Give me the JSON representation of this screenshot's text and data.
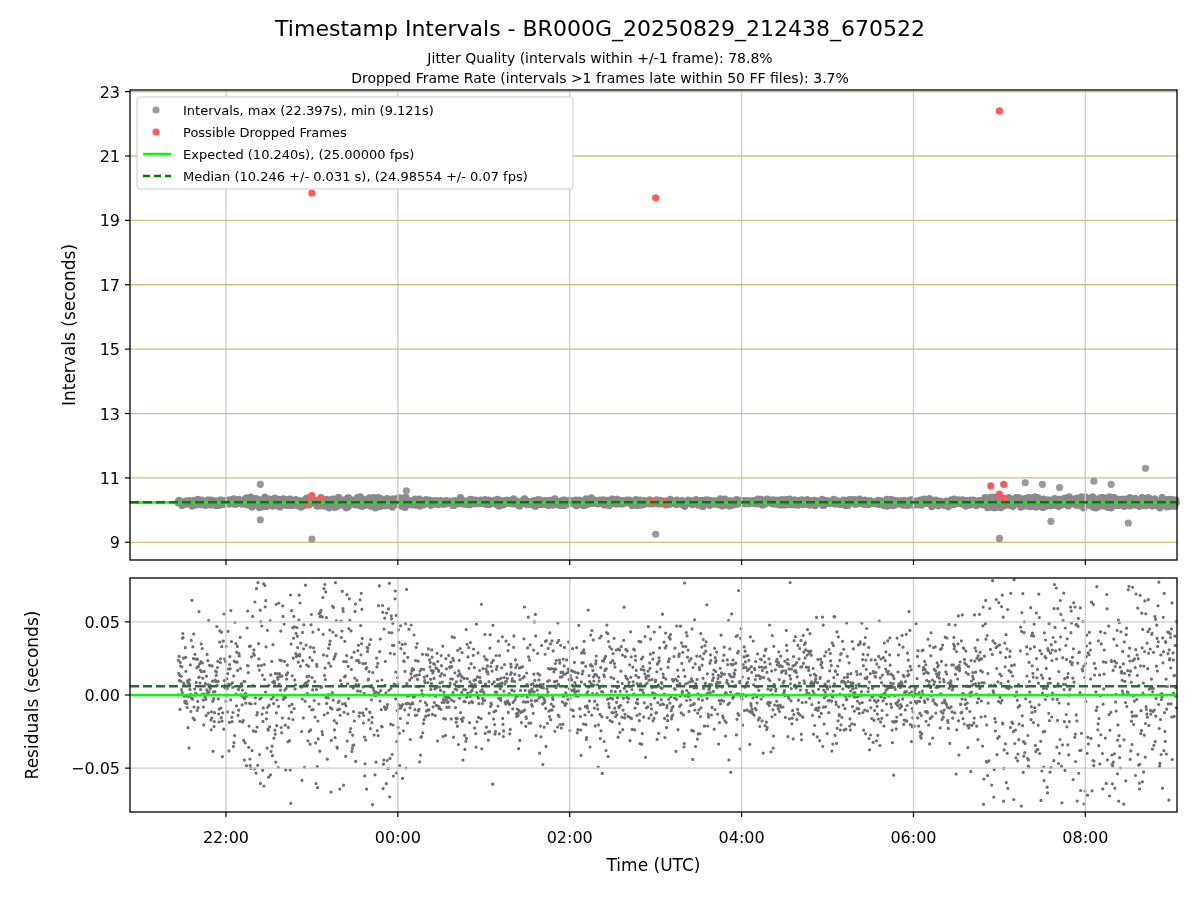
{
  "figure": {
    "title": "Timestamp Intervals - BR000G_20250829_212438_670522",
    "subtitle_lines": [
      "Jitter Quality (intervals within +/-1 frame): 78.8%",
      "Dropped Frame Rate (intervals >1 frames late within 50 FF files): 3.7%"
    ]
  },
  "intervals_plot": {
    "chart_data": {
      "type": "scatter",
      "ylabel": "Intervals (seconds)",
      "xlim": [
        "2025-08-29T20:53",
        "2025-08-30T09:04"
      ],
      "ylim": [
        8.45,
        23.05
      ],
      "yticks": [
        23,
        21,
        19,
        17,
        15,
        13,
        11,
        9
      ],
      "grid": true,
      "series": [
        {
          "name": "Intervals, max (22.397s), min (9.121s)",
          "color": "#999999",
          "x": [
            "2025-08-29T22:24",
            "2025-08-29T22:24",
            "2025-08-29T23:00",
            "2025-08-30T00:06",
            "2025-08-30T03:00",
            "2025-08-30T07:00",
            "2025-08-30T08:42",
            "2025-08-30T07:18",
            "2025-08-30T07:30",
            "2025-08-30T08:06",
            "2025-08-30T08:18",
            "2025-08-30T07:42",
            "2025-08-30T08:30",
            "2025-08-30T07:36"
          ],
          "values": [
            10.8,
            9.7,
            9.1,
            10.6,
            9.25,
            9.12,
            11.3,
            10.85,
            10.8,
            10.9,
            10.8,
            10.7,
            9.6,
            9.65
          ]
        },
        {
          "name": "Possible Dropped Frames",
          "color": "#ff5a5a",
          "x": [
            "2025-08-29T23:00",
            "2025-08-30T03:00",
            "2025-08-30T07:00",
            "2025-08-29T23:00",
            "2025-08-29T22:57",
            "2025-08-29T23:06",
            "2025-08-30T03:06",
            "2025-08-30T02:57",
            "2025-08-30T06:54",
            "2025-08-30T07:00",
            "2025-08-30T07:03",
            "2025-08-30T07:03"
          ],
          "values": [
            19.85,
            19.7,
            22.4,
            10.45,
            10.2,
            10.35,
            10.25,
            10.26,
            10.75,
            10.5,
            10.8,
            10.35
          ]
        }
      ],
      "ref_lines": [
        {
          "axis": "y",
          "value": 10.24,
          "label": "Expected (10.240s), (25.00000 fps)",
          "color": "#00ff00"
        },
        {
          "axis": "y",
          "value": 10.246,
          "label": "Median (10.246 +/- 0.031 s), (24.98554 +/- 0.07 fps)",
          "color": "#008000"
        }
      ],
      "legend": true
    }
  },
  "residuals_plot": {
    "chart_data": {
      "type": "scatter",
      "xlabel": "Time (UTC)",
      "ylabel": "Residuals (seconds)",
      "xlim": [
        "2025-08-29T20:53",
        "2025-08-30T09:04"
      ],
      "ylim": [
        -0.08,
        0.08
      ],
      "grid": true,
      "xticks": [
        {
          "value": "2025-08-29T22:00",
          "label": "22:00"
        },
        {
          "value": "2025-08-30T00:00",
          "label": "00:00"
        },
        {
          "value": "2025-08-30T02:00",
          "label": "02:00"
        },
        {
          "value": "2025-08-30T04:00",
          "label": "04:00"
        },
        {
          "value": "2025-08-30T06:00",
          "label": "06:00"
        },
        {
          "value": "2025-08-30T08:00",
          "label": "08:00"
        }
      ],
      "yticks": [
        {
          "value": 0.05,
          "label": "0.05"
        },
        {
          "value": 0,
          "label": "0.00"
        },
        {
          "value": -0.05,
          "label": "−0.05"
        }
      ],
      "ref_lines": [
        {
          "axis": "y",
          "value": 0,
          "color": "#00ff00"
        },
        {
          "axis": "y",
          "value": 0.006,
          "color": "#2e6b2e"
        }
      ]
    }
  }
}
